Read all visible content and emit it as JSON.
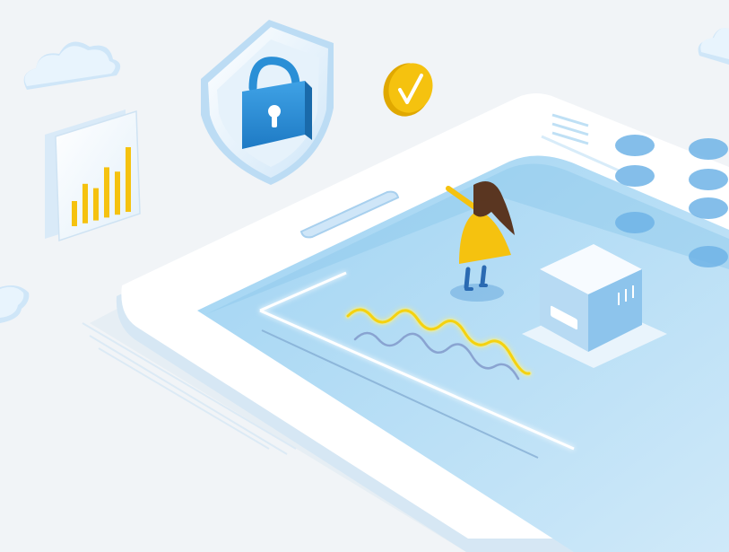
{
  "scene": {
    "kind": "isometric-illustration",
    "subject": "smartphone-security",
    "colors": {
      "background": "#f1f4f7",
      "phone_body": "#ffffff",
      "phone_edge": "#d9e7f3",
      "screen": "#8fcaee",
      "screen_light": "#bfe2f7",
      "shield_blue": "#2a8fd6",
      "shield_light": "#c9e4f7",
      "accent_yellow": "#f5c20f",
      "dot_blue": "#6fb3e6",
      "cloud": "#dfeefa",
      "server_top": "#eef6fc",
      "server_side": "#a9d3f1"
    },
    "icons": [
      "cloud-icon",
      "bar-chart-icon",
      "shield-lock-icon",
      "checkmark-coin-icon",
      "server-box-icon",
      "person-figure-icon"
    ],
    "bar_chart_levels": [
      0.35,
      0.55,
      0.45,
      0.7,
      0.6,
      0.9
    ]
  }
}
